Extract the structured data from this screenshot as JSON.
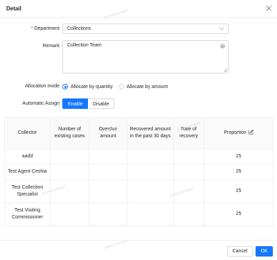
{
  "dialog": {
    "title": "Detail",
    "close_icon": "close-icon"
  },
  "form": {
    "department": {
      "label": "Department",
      "required_mark": "*",
      "value": "Collections"
    },
    "remark": {
      "label": "Remark",
      "value": "Collection Team"
    },
    "allocation_mode": {
      "label": "Allocation mode",
      "options": [
        {
          "label": "Allocate by quantity",
          "selected": true
        },
        {
          "label": "Allocate by amount",
          "selected": false
        }
      ]
    },
    "automatic_assign": {
      "label": "Automatic Assign",
      "enable_label": "Enable",
      "disable_label": "Disable",
      "selected": "Enable"
    }
  },
  "table": {
    "headers": [
      "Collector",
      "Number of existing cases",
      "Overdue amount",
      "Recovered amount in the past 30 days",
      "Rate of recovery",
      "Proportion"
    ],
    "rows": [
      {
        "collector": "aadd",
        "existing_cases": "",
        "overdue_amount": "",
        "recovered_30d": "",
        "rate": "",
        "proportion": "25"
      },
      {
        "collector": "Test Agent Ceshia",
        "existing_cases": "",
        "overdue_amount": "",
        "recovered_30d": "",
        "rate": "",
        "proportion": "25"
      },
      {
        "collector": "Test Collection Specialist",
        "existing_cases": "",
        "overdue_amount": "",
        "recovered_30d": "",
        "rate": "",
        "proportion": "25"
      },
      {
        "collector": "Test Visiting Commissioner",
        "existing_cases": "",
        "overdue_amount": "",
        "recovered_30d": "",
        "rate": "",
        "proportion": "25"
      }
    ]
  },
  "watermark": "Administrator",
  "footer": {
    "cancel_label": "Cancel",
    "ok_label": "OK"
  },
  "colors": {
    "primary": "#1677ff",
    "required": "#f5222d",
    "border": "#d9d9d9"
  }
}
